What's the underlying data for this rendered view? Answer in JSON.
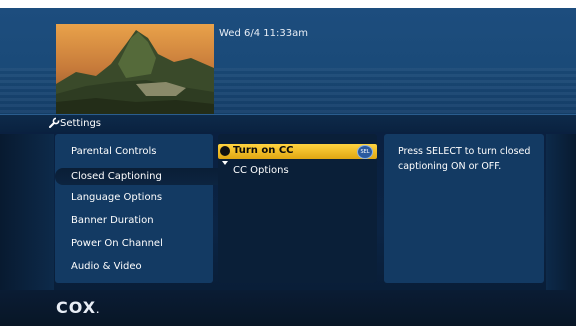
{
  "header": {
    "datetime": "Wed 6/4  11:33am",
    "thumbnail_icon": "mountain-landscape"
  },
  "settings_bar": {
    "title": "Settings",
    "icon": "wrench-icon"
  },
  "menu": {
    "items": [
      {
        "label": "Parental Controls"
      },
      {
        "label": "Closed Captioning",
        "selected": true
      },
      {
        "label": "Language Options"
      },
      {
        "label": "Banner Duration"
      },
      {
        "label": "Power On Channel"
      },
      {
        "label": "Audio & Video"
      }
    ]
  },
  "submenu": {
    "selected_label": "Turn on CC",
    "sel_badge": "SEL",
    "items": [
      {
        "label": "CC Options"
      }
    ]
  },
  "help": {
    "text": "Press SELECT to turn closed captioning ON or OFF."
  },
  "footer": {
    "logo": "COX",
    "logo_dot": "."
  },
  "colors": {
    "highlight": "#f5c12a",
    "panel": "#133a63",
    "background": "#0a1f38"
  }
}
